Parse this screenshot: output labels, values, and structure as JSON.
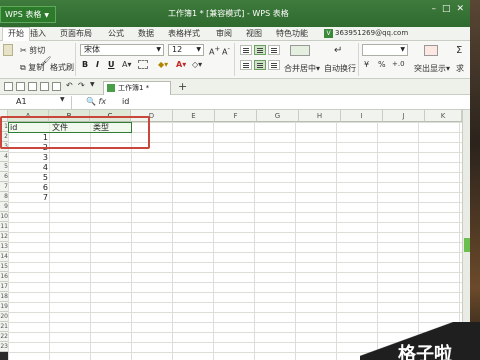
{
  "titlebar": {
    "app_button": "WPS 表格",
    "title": "工作簿1 * [兼容模式] - WPS 表格",
    "controls": [
      "–",
      "□",
      "✕"
    ]
  },
  "menu": {
    "items": [
      "开始",
      "插入",
      "页面布局",
      "公式",
      "数据",
      "表格样式",
      "审阅",
      "视图",
      "特色功能"
    ],
    "account": "363951269@qq.com",
    "account_badge": "V"
  },
  "ribbon": {
    "cut": "剪切",
    "copy": "复制",
    "format_painter": "格式刷",
    "font_name": "宋体",
    "font_size": "12",
    "bold": "B",
    "italic": "I",
    "underline": "U",
    "merge": "合并居中",
    "wrap": "自动换行",
    "currency": "¥",
    "percent": "%",
    "highlight": "突出显示",
    "sum": "求"
  },
  "tabs": {
    "doc_tab": "工作簿1 *",
    "add": "+"
  },
  "formula_bar": {
    "name_box": "A1",
    "fx": "fx",
    "value": "id"
  },
  "grid": {
    "columns": [
      "A",
      "B",
      "C",
      "D",
      "E",
      "F",
      "G",
      "H",
      "I",
      "J",
      "K"
    ],
    "header_row": [
      "id",
      "文件",
      "类型"
    ],
    "ids": [
      "1",
      "2",
      "3",
      "4",
      "5",
      "6",
      "7"
    ],
    "row_numbers": [
      "1",
      "2",
      "3",
      "4",
      "5",
      "6",
      "7",
      "8",
      "9",
      "10",
      "11",
      "12",
      "13",
      "14",
      "15",
      "16",
      "17",
      "18",
      "19",
      "20",
      "21",
      "22",
      "23"
    ]
  },
  "watermark": "格子啦"
}
